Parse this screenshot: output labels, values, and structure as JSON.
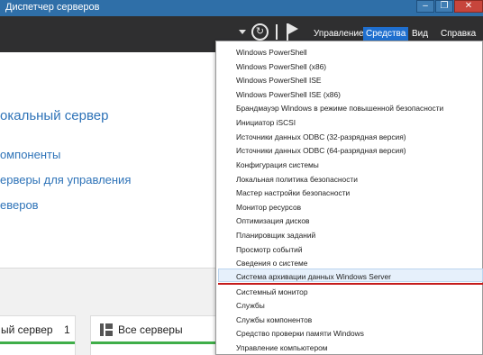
{
  "window": {
    "title": "Диспетчер серверов",
    "controls": {
      "minimize": "–",
      "maximize": "❐",
      "close": "✕"
    }
  },
  "toolbar": {
    "menu": [
      "Управление",
      "Средства",
      "Вид",
      "Справка"
    ],
    "active_menu": "Средства",
    "accent_color": "#1f6fcf"
  },
  "main": {
    "welcome_links": [
      "окальный сервер",
      "омпоненты",
      "ерверы для управления",
      "еверов"
    ]
  },
  "tiles": [
    {
      "label": "ый сервер",
      "count": "1"
    },
    {
      "label": "Все серверы"
    }
  ],
  "tools_menu": {
    "items": [
      "Windows PowerShell",
      "Windows PowerShell (x86)",
      "Windows PowerShell ISE",
      "Windows PowerShell ISE (x86)",
      "Брандмауэр Windows в режиме повышенной безопасности",
      "Инициатор iSCSI",
      "Источники данных ODBC (32-разрядная версия)",
      "Источники данных ODBC (64-разрядная версия)",
      "Конфигурация системы",
      "Локальная политика безопасности",
      "Мастер настройки безопасности",
      "Монитор ресурсов",
      "Оптимизация дисков",
      "Планировщик заданий",
      "Просмотр событий",
      "Сведения о системе",
      "Система архивации данных Windows Server",
      "Системный монитор",
      "Службы",
      "Службы компонентов",
      "Средство проверки памяти Windows",
      "Управление компьютером"
    ],
    "highlighted": "Система архивации данных Windows Server",
    "highlight_underline_color": "#c41b1b"
  }
}
